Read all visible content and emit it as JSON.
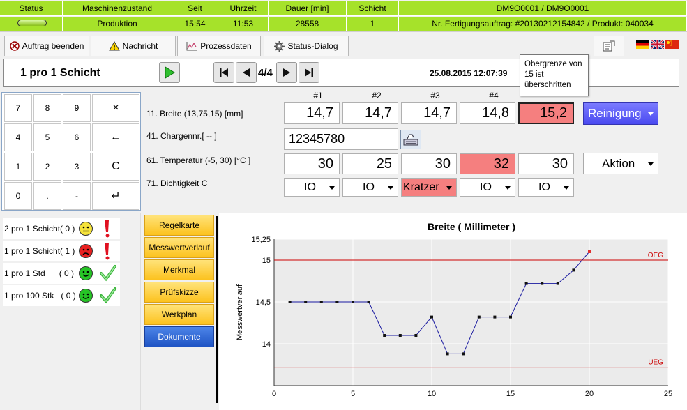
{
  "status_bar": {
    "headers": [
      "Status",
      "Maschinenzustand",
      "Seit",
      "Uhrzeit",
      "Dauer [min]",
      "Schicht",
      "DM9O0001 / DM9O0001"
    ],
    "values": [
      "",
      "Produktion",
      "15:54",
      "11:53",
      "28558",
      "1",
      "Nr. Fertigungsauftrag: #20130212154842 / Produkt: 040034"
    ]
  },
  "toolbar": {
    "end_order": "Auftrag beenden",
    "message": "Nachricht",
    "process_data": "Prozessdaten",
    "status_dialog": "Status-Dialog"
  },
  "nav": {
    "title": "1 pro 1 Schicht",
    "page": "4/4",
    "datetime": "25.08.2015 12:07:39"
  },
  "tooltip": "Obergrenze von 15 ist überschritten",
  "keypad": [
    "7",
    "8",
    "9",
    "×",
    "4",
    "5",
    "6",
    "←",
    "1",
    "2",
    "3",
    "C",
    "0",
    ".",
    "-",
    "↵"
  ],
  "columns": [
    "#1",
    "#2",
    "#3",
    "#4"
  ],
  "rows": {
    "breite_label": "11. Breite (13,75,15) [mm]",
    "breite_values": [
      "14,7",
      "14,7",
      "14,7",
      "14,8",
      "15,2"
    ],
    "charge_label": "41. Chargennr.[ -- ]",
    "charge_value": "12345780",
    "temp_label": "61. Temperatur (-5, 30) [°C ]",
    "temp_values": [
      "30",
      "25",
      "30",
      "32",
      "30"
    ],
    "dicht_label": "71. Dichtigkeit C",
    "dicht_values": [
      "IO",
      "IO",
      "Kratzer",
      "IO",
      "IO"
    ]
  },
  "buttons": {
    "reinigung": "Reinigung",
    "aktion": "Aktion"
  },
  "status_list": [
    {
      "label": "2 pro 1 Schicht( 0 )",
      "face": "neutral"
    },
    {
      "label": "1 pro 1 Schicht( 1 )",
      "face": "sad"
    },
    {
      "label": "1 pro 1 Std      ( 0 )",
      "face": "happy"
    },
    {
      "label": "1 pro 100 Stk   ( 0 )",
      "face": "happy"
    }
  ],
  "side_buttons": [
    "Regelkarte",
    "Messwertverlauf",
    "Merkmal",
    "Prüfskizze",
    "Werkplan",
    "Dokumente"
  ],
  "colors": {
    "status_green": "#a6e22a",
    "alarm_red": "#f57f7f",
    "chart_line": "#1a1aa0",
    "limit_red": "#cc0000"
  },
  "chart_data": {
    "type": "line",
    "title": "Breite ( Millimeter )",
    "ylabel": "Messwertverlauf",
    "xlabel": "",
    "xlim": [
      0,
      25
    ],
    "ylim": [
      13.5,
      15.25
    ],
    "x_ticks": [
      "0",
      "5",
      "10",
      "15",
      "20",
      "25"
    ],
    "y_ticks": [
      "14",
      "14,5",
      "15",
      "15,25"
    ],
    "grid": true,
    "limits": [
      {
        "name": "OEG",
        "value": 15.0
      },
      {
        "name": "UEG",
        "value": 13.72
      }
    ],
    "x": [
      1,
      2,
      3,
      4,
      5,
      6,
      7,
      8,
      9,
      10,
      11,
      12,
      13,
      14,
      15,
      16,
      17,
      18,
      19,
      20
    ],
    "values": [
      14.5,
      14.5,
      14.5,
      14.5,
      14.5,
      14.5,
      14.1,
      14.1,
      14.1,
      14.32,
      13.88,
      13.88,
      14.32,
      14.32,
      14.32,
      14.72,
      14.72,
      14.72,
      14.88,
      15.1
    ]
  }
}
